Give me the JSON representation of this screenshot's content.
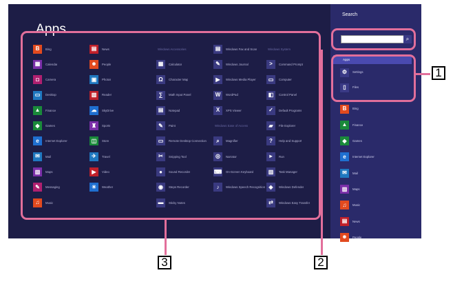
{
  "apps_screen": {
    "title": "Apps",
    "group_headers": [
      "Windows Accessories",
      "Windows System",
      "Windows Ease of Access"
    ],
    "columns": [
      [
        {
          "label": "Bing",
          "color": "#e24a1f",
          "icon": "B"
        },
        {
          "label": "Calendar",
          "color": "#7a2fa8",
          "icon": "▦"
        },
        {
          "label": "Camera",
          "color": "#b02070",
          "icon": "◘"
        },
        {
          "label": "Desktop",
          "color": "#1f78c0",
          "icon": "▭"
        },
        {
          "label": "Finance",
          "color": "#1a8a3a",
          "icon": "▲"
        },
        {
          "label": "Games",
          "color": "#1a8a3a",
          "icon": "◆"
        },
        {
          "label": "Internet Explorer",
          "color": "#1f6fd0",
          "icon": "e"
        },
        {
          "label": "Mail",
          "color": "#1f78c0",
          "icon": "✉"
        },
        {
          "label": "Maps",
          "color": "#7a2fa8",
          "icon": "▥"
        },
        {
          "label": "Messaging",
          "color": "#b02070",
          "icon": "✎"
        },
        {
          "label": "Music",
          "color": "#e24a1f",
          "icon": "♫"
        }
      ],
      [
        {
          "label": "News",
          "color": "#c0202a",
          "icon": "▤"
        },
        {
          "label": "People",
          "color": "#e24a1f",
          "icon": "☻"
        },
        {
          "label": "Photos",
          "color": "#1f78c0",
          "icon": "▣"
        },
        {
          "label": "Reader",
          "color": "#c0202a",
          "icon": "▧"
        },
        {
          "label": "SkyDrive",
          "color": "#1f6fd0",
          "icon": "☁"
        },
        {
          "label": "Sports",
          "color": "#7a2fa8",
          "icon": "♜"
        },
        {
          "label": "Store",
          "color": "#1a8a3a",
          "icon": "◫"
        },
        {
          "label": "Travel",
          "color": "#1f78c0",
          "icon": "✈"
        },
        {
          "label": "Video",
          "color": "#c0202a",
          "icon": "▶"
        },
        {
          "label": "Weather",
          "color": "#1f6fd0",
          "icon": "☀"
        }
      ],
      [
        {
          "label": "Calculator",
          "color": "#3a3a80",
          "icon": "▦"
        },
        {
          "label": "Character Map",
          "color": "#3a3a80",
          "icon": "Ω"
        },
        {
          "label": "Math Input Panel",
          "color": "#3a3a80",
          "icon": "∑"
        },
        {
          "label": "Notepad",
          "color": "#3a3a80",
          "icon": "▤"
        },
        {
          "label": "Paint",
          "color": "#3a3a80",
          "icon": "✎"
        },
        {
          "label": "Remote Desktop Connection",
          "color": "#3a3a80",
          "icon": "▭"
        },
        {
          "label": "Snipping Tool",
          "color": "#3a3a80",
          "icon": "✂"
        },
        {
          "label": "Sound Recorder",
          "color": "#3a3a80",
          "icon": "●"
        },
        {
          "label": "Steps Recorder",
          "color": "#3a3a80",
          "icon": "◉"
        },
        {
          "label": "Sticky Notes",
          "color": "#3a3a80",
          "icon": "▬"
        }
      ],
      [
        {
          "label": "Windows Fax and Scan",
          "color": "#3a3a80",
          "icon": "▤"
        },
        {
          "label": "Windows Journal",
          "color": "#3a3a80",
          "icon": "✎"
        },
        {
          "label": "Windows Media Player",
          "color": "#3a3a80",
          "icon": "▶"
        },
        {
          "label": "WordPad",
          "color": "#3a3a80",
          "icon": "W"
        },
        {
          "label": "XPS Viewer",
          "color": "#3a3a80",
          "icon": "X"
        },
        {
          "label": "Magnifier",
          "color": "#3a3a80",
          "icon": "⌕"
        },
        {
          "label": "Narrator",
          "color": "#3a3a80",
          "icon": "◎"
        },
        {
          "label": "On-Screen Keyboard",
          "color": "#3a3a80",
          "icon": "⌨"
        },
        {
          "label": "Windows Speech Recognition",
          "color": "#3a3a80",
          "icon": "♪"
        }
      ],
      [
        {
          "label": "Command Prompt",
          "color": "#3a3a80",
          "icon": ">"
        },
        {
          "label": "Computer",
          "color": "#3a3a80",
          "icon": "▭"
        },
        {
          "label": "Control Panel",
          "color": "#3a3a80",
          "icon": "◧"
        },
        {
          "label": "Default Programs",
          "color": "#3a3a80",
          "icon": "✓"
        },
        {
          "label": "File Explorer",
          "color": "#3a3a80",
          "icon": "▰"
        },
        {
          "label": "Help and Support",
          "color": "#3a3a80",
          "icon": "?"
        },
        {
          "label": "Run",
          "color": "#3a3a80",
          "icon": "▸"
        },
        {
          "label": "Task Manager",
          "color": "#3a3a80",
          "icon": "▥"
        },
        {
          "label": "Windows Defender",
          "color": "#3a3a80",
          "icon": "◈"
        },
        {
          "label": "Windows Easy Transfer",
          "color": "#3a3a80",
          "icon": "⇄"
        }
      ]
    ]
  },
  "search_pane": {
    "title": "Search",
    "search_value": "",
    "search_button": "⌕",
    "selected_category": "Apps",
    "categories": [
      {
        "label": "Settings",
        "icon": "⚙"
      },
      {
        "label": "Files",
        "icon": "▯"
      }
    ],
    "results": [
      {
        "label": "Bing",
        "color": "#e24a1f",
        "icon": "B"
      },
      {
        "label": "Finance",
        "color": "#1a8a3a",
        "icon": "▲"
      },
      {
        "label": "Games",
        "color": "#1a8a3a",
        "icon": "◆"
      },
      {
        "label": "Internet Explorer",
        "color": "#1f6fd0",
        "icon": "e"
      },
      {
        "label": "Mail",
        "color": "#1f78c0",
        "icon": "✉"
      },
      {
        "label": "Maps",
        "color": "#7a2fa8",
        "icon": "▥"
      },
      {
        "label": "Music",
        "color": "#e24a1f",
        "icon": "♫"
      },
      {
        "label": "News",
        "color": "#c0202a",
        "icon": "▤"
      },
      {
        "label": "People",
        "color": "#e24a1f",
        "icon": "☻"
      }
    ]
  },
  "callouts": {
    "one": "1",
    "two": "2",
    "three": "3",
    "color": "#e26f9b"
  }
}
